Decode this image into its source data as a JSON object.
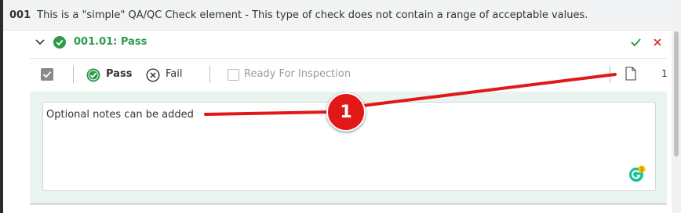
{
  "header": {
    "number": "001",
    "description": "This is a \"simple\" QA/QC Check element - This type of check does not contain a range of acceptable values."
  },
  "check": {
    "title": "001.01: Pass",
    "pass_label": "Pass",
    "fail_label": "Fail",
    "ready_label": "Ready For Inspection",
    "attachment_count": "1"
  },
  "notes": {
    "text": "Optional notes can be added",
    "grammarly_badge": "1"
  },
  "callout": {
    "number": "1"
  },
  "icons": [
    "chevron-down-icon",
    "check-circle-icon",
    "checkmark-icon",
    "close-icon",
    "checkbox-icon",
    "x-circle-icon",
    "document-icon",
    "grammarly-icon"
  ],
  "colors": {
    "pass_green": "#2e9a4a",
    "close_red": "#d9342b",
    "notes_panel": "#e9f4ee",
    "callout_red": "#e21818"
  }
}
